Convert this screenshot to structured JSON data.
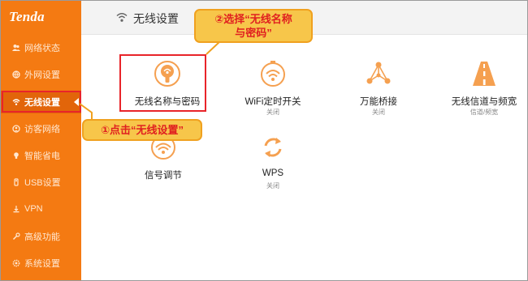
{
  "brand": {
    "logo": "Tenda"
  },
  "sidebar": {
    "items": [
      {
        "label": "网络状态",
        "icon": "users-icon"
      },
      {
        "label": "外网设置",
        "icon": "globe-icon"
      },
      {
        "label": "无线设置",
        "icon": "wifi-icon",
        "active": true
      },
      {
        "label": "访客网络",
        "icon": "guest-icon"
      },
      {
        "label": "智能省电",
        "icon": "bulb-icon"
      },
      {
        "label": "USB设置",
        "icon": "usb-icon"
      },
      {
        "label": "VPN",
        "icon": "vpn-icon"
      },
      {
        "label": "高级功能",
        "icon": "tools-icon"
      },
      {
        "label": "系统设置",
        "icon": "gear-icon"
      }
    ]
  },
  "header": {
    "title": "无线设置",
    "icon": "wifi-icon"
  },
  "tiles": [
    {
      "label": "无线名称与密码",
      "sub": "",
      "icon": "wireless-name-password-icon"
    },
    {
      "label": "WiFi定时开关",
      "sub": "关闭",
      "icon": "wifi-schedule-icon"
    },
    {
      "label": "万能桥接",
      "sub": "关闭",
      "icon": "bridge-icon"
    },
    {
      "label": "无线信道与频宽",
      "sub": "信道/频宽",
      "icon": "channel-road-icon"
    },
    {
      "label": "信号调节",
      "sub": "",
      "icon": "signal-adjust-icon"
    },
    {
      "label": "WPS",
      "sub": "关闭",
      "icon": "wps-icon"
    }
  ],
  "annotations": {
    "step1": "①点击“无线设置”",
    "step2_line1": "②选择“无线名称",
    "step2_line2": "与密码”"
  },
  "colors": {
    "sidebar_bg": "#f47a12",
    "sidebar_active_bg": "#e2650a",
    "icon_orange": "#f5a050",
    "highlight_red": "#e8242a",
    "callout_fill": "#f7c64a"
  }
}
